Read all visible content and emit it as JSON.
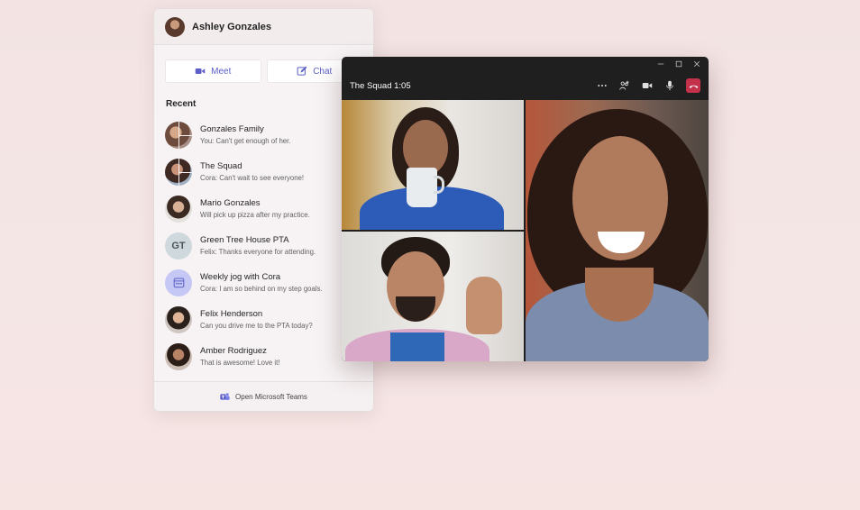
{
  "panel": {
    "owner_name": "Ashley Gonzales",
    "meet_label": "Meet",
    "chat_label": "Chat",
    "recent_title": "Recent",
    "chats": [
      {
        "name": "Gonzales Family",
        "preview": "You: Can't get enough of her."
      },
      {
        "name": "The Squad",
        "preview": "Cora: Can't wait to see everyone!"
      },
      {
        "name": "Mario Gonzales",
        "preview": "Will pick up pizza after my practice."
      },
      {
        "name": "Green Tree House PTA",
        "preview": "Felix: Thanks everyone for attending.",
        "initials": "GT"
      },
      {
        "name": "Weekly jog with Cora",
        "preview": "Cora: I am so behind on my step goals."
      },
      {
        "name": "Felix Henderson",
        "preview": "Can you drive me to the PTA today?"
      },
      {
        "name": "Amber Rodriguez",
        "preview": "That is awesome! Love it!"
      }
    ],
    "footer_label": "Open Microsoft Teams"
  },
  "call": {
    "title": "The Squad 1:05",
    "icons": [
      "more-icon",
      "add-people-icon",
      "video-camera-icon",
      "microphone-icon",
      "hang-up-icon"
    ]
  },
  "colors": {
    "accent": "#5b5fc7",
    "hangup": "#c4314b",
    "call_bg": "#1f1f1f"
  }
}
